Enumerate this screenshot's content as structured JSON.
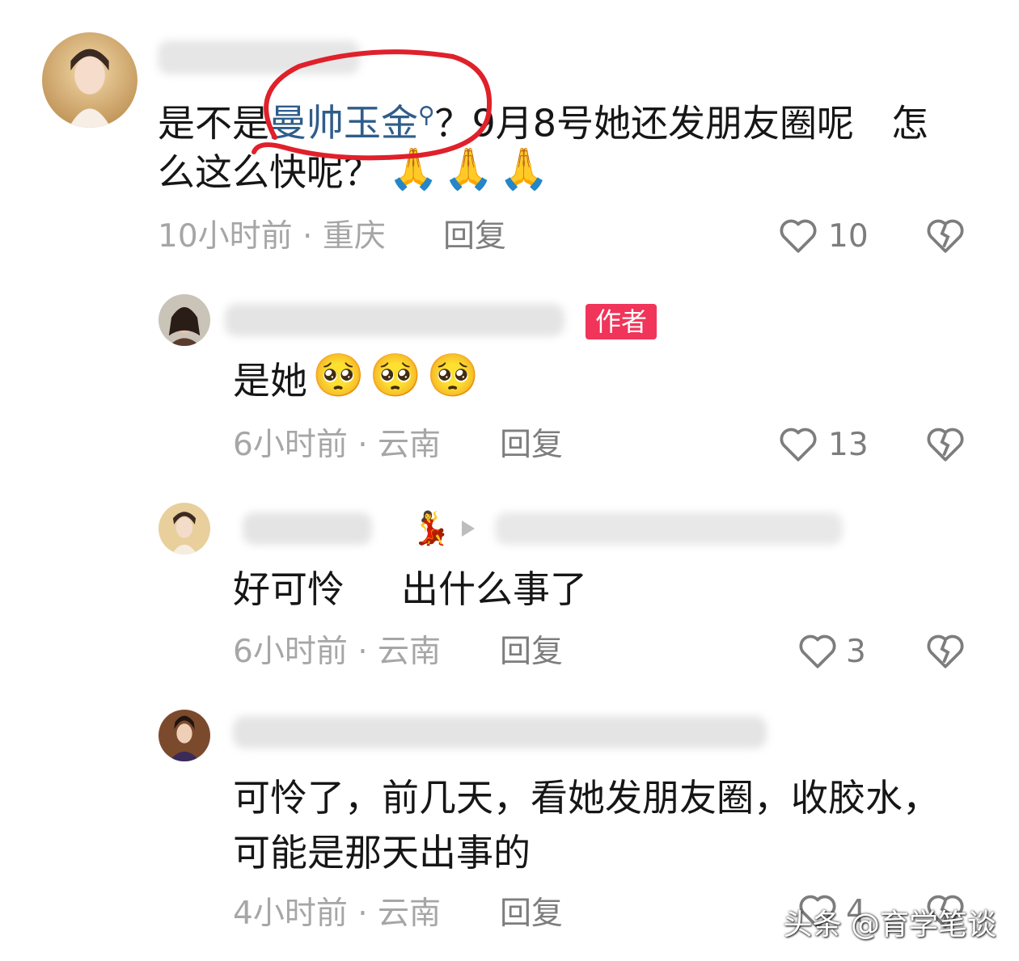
{
  "comments": [
    {
      "text_line1_prefix": "是不是",
      "text_link": "曼帅玉金",
      "text_line1_suffix": "？9月8号她还发朋友圈呢　怎",
      "text_line2": "么这么快呢？",
      "emoji": [
        "🙏",
        "🙏",
        "🙏"
      ],
      "time": "10小时前",
      "location": "重庆",
      "reply_label": "回复",
      "likes": "10"
    },
    {
      "badge": "作者",
      "text": "是她",
      "emoji": [
        "🥺",
        "🥺",
        "🥺"
      ],
      "time": "6小时前",
      "location": "云南",
      "reply_label": "回复",
      "likes": "13"
    },
    {
      "text_a": "好可怜",
      "text_b": "出什么事了",
      "time": "6小时前",
      "location": "云南",
      "reply_label": "回复",
      "likes": "3"
    },
    {
      "text_line1": "可怜了，前几天，看她发朋友圈，收胶水，",
      "text_line2": "可能是那天出事的",
      "time": "4小时前",
      "location": "云南",
      "reply_label": "回复",
      "likes": "4"
    }
  ],
  "separator": "·",
  "watermark": "头条 @育学笔谈",
  "colors": {
    "badge": "#f0345a",
    "link": "#2f5d8a",
    "annotation": "#e0202a"
  }
}
